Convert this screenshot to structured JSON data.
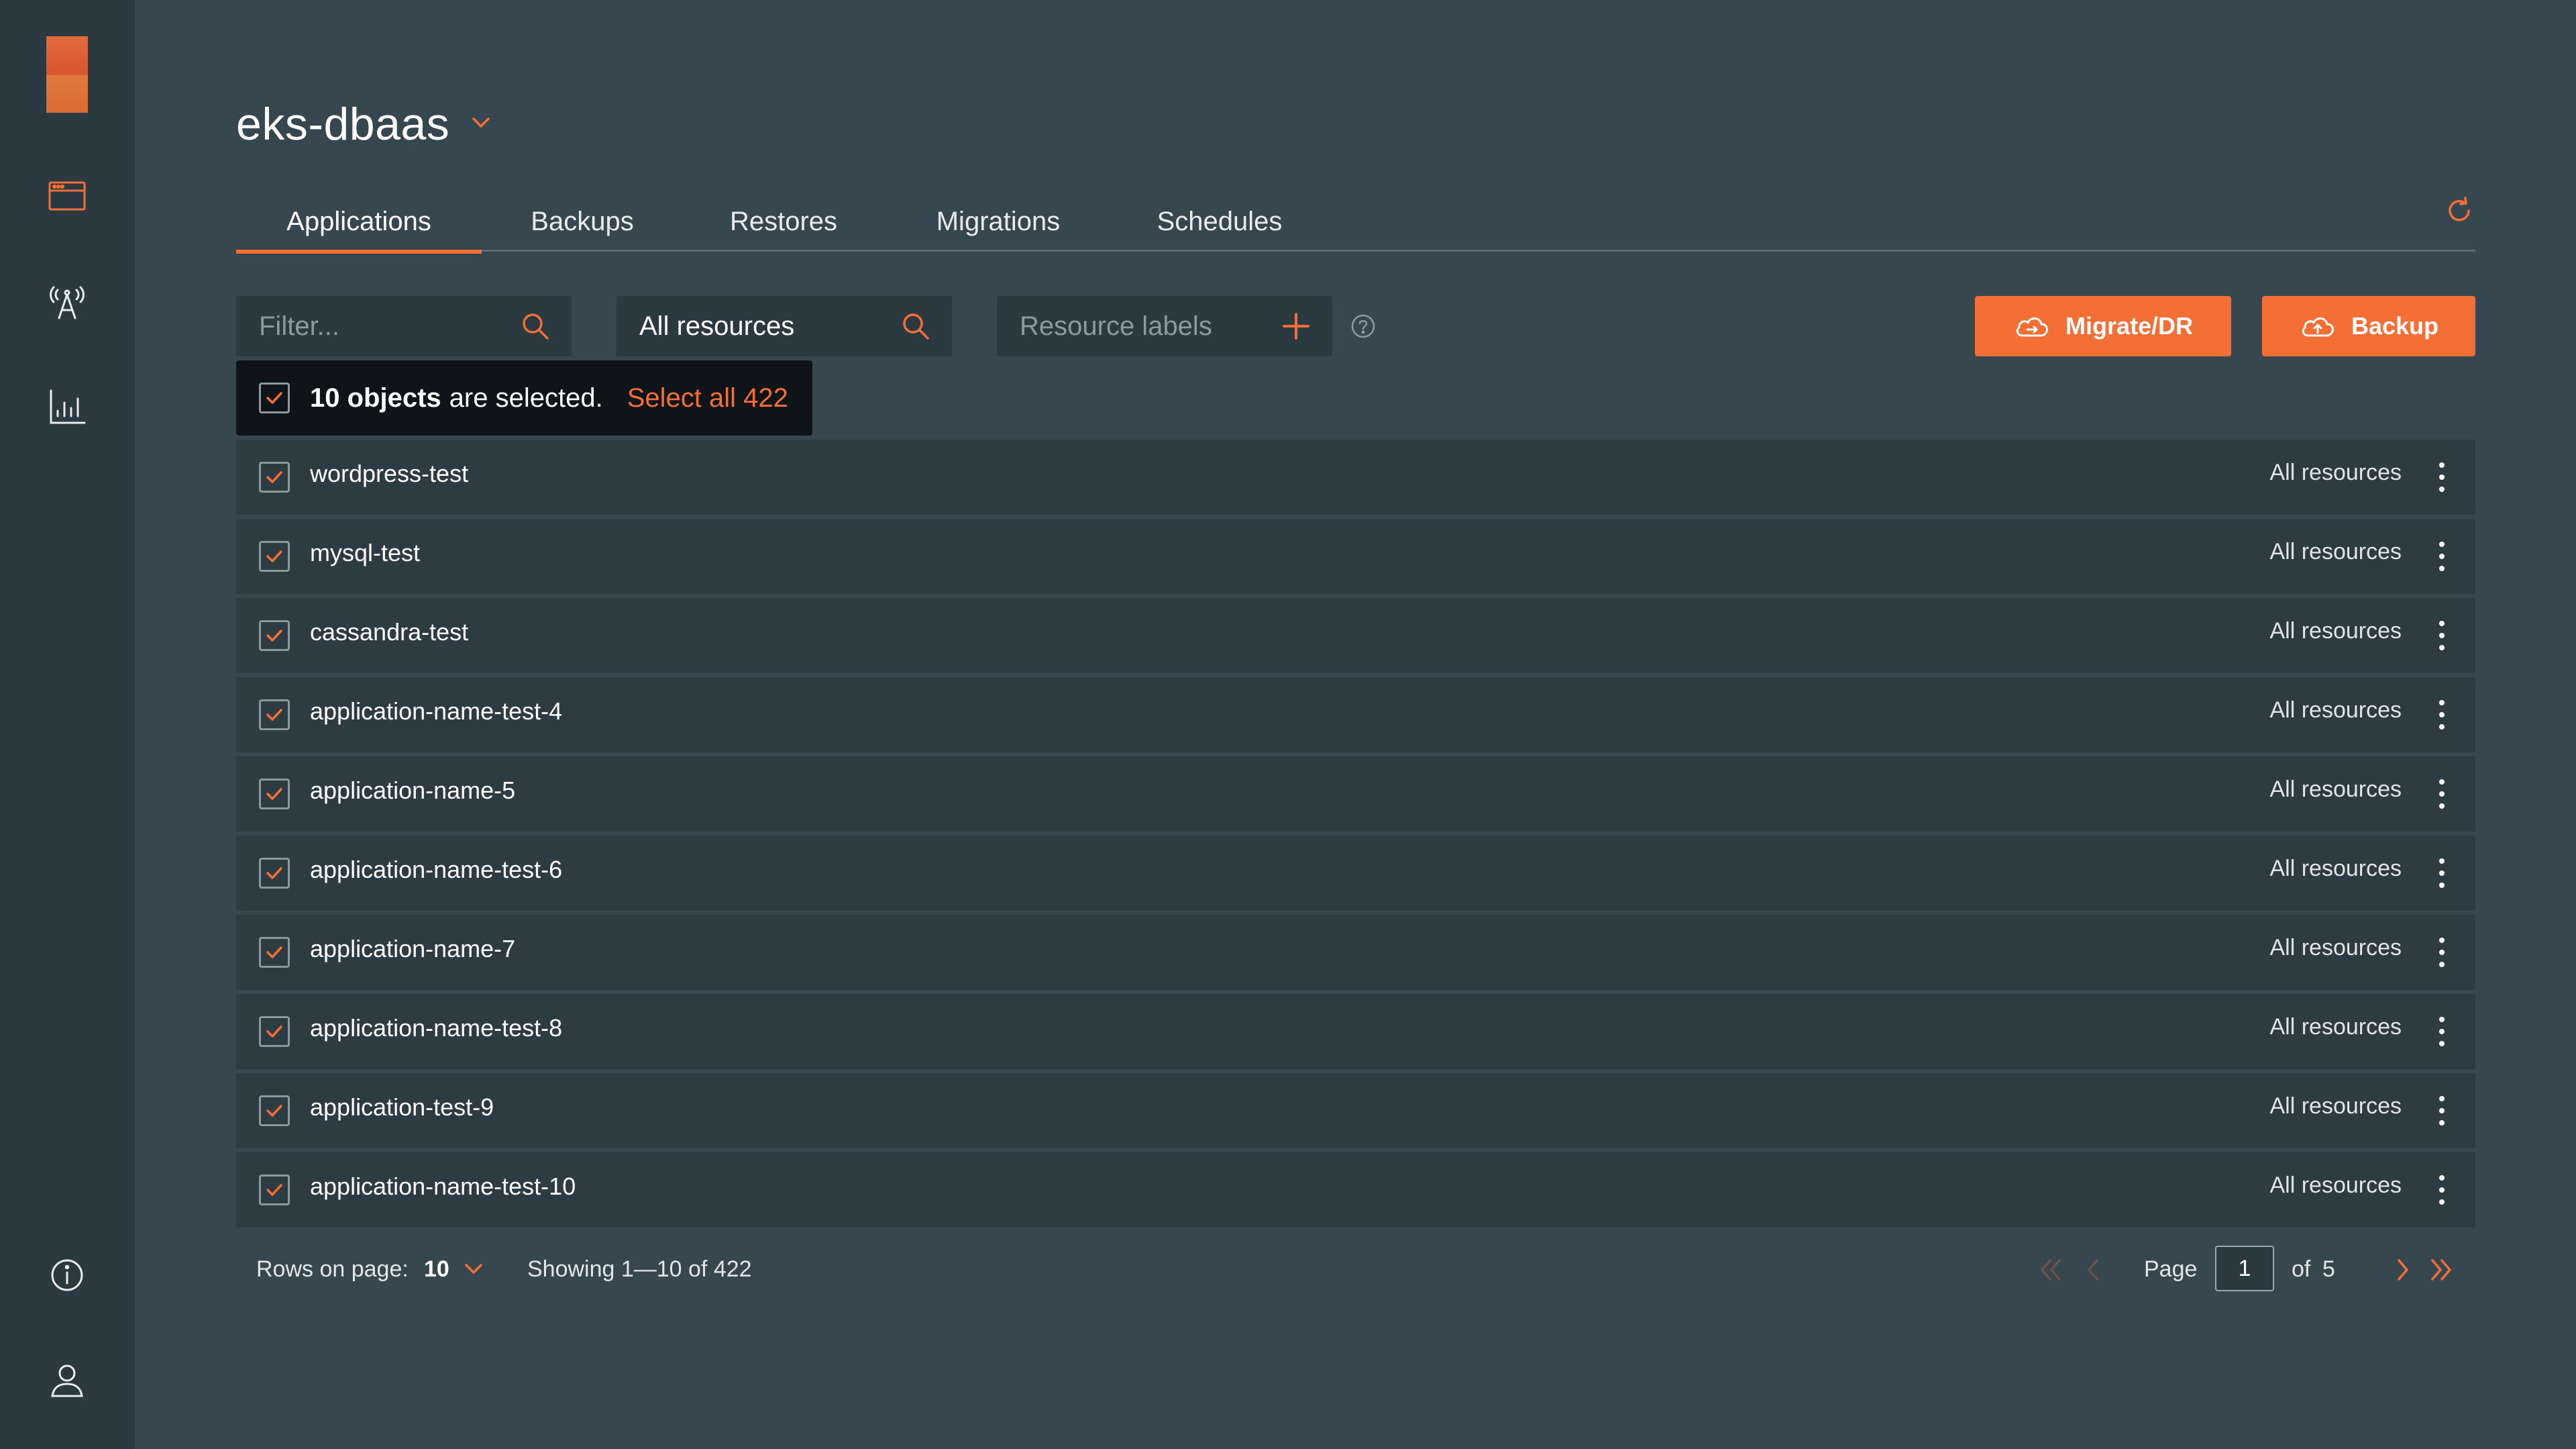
{
  "colors": {
    "accent": "#f36f36",
    "sidebar": "#2b3940",
    "background": "#37474f",
    "row": "#2d3b42"
  },
  "sidebar": {
    "icons": [
      "browser-window-icon",
      "antenna-icon",
      "bar-chart-icon",
      "info-icon",
      "user-icon"
    ]
  },
  "header": {
    "project_name": "eks-dbaas"
  },
  "tabs": [
    {
      "label": "Applications",
      "active": true
    },
    {
      "label": "Backups",
      "active": false
    },
    {
      "label": "Restores",
      "active": false
    },
    {
      "label": "Migrations",
      "active": false
    },
    {
      "label": "Schedules",
      "active": false
    }
  ],
  "toolbar": {
    "filter_placeholder": "Filter...",
    "resources_value": "All resources",
    "labels_placeholder": "Resource labels",
    "migrate_label": "Migrate/DR",
    "backup_label": "Backup"
  },
  "selection": {
    "count_text": "10 objects",
    "suffix": "are selected.",
    "select_all": "Select all 422"
  },
  "rows": [
    {
      "name": "wordpress-test",
      "scope": "All resources",
      "checked": true
    },
    {
      "name": "mysql-test",
      "scope": "All resources",
      "checked": true
    },
    {
      "name": "cassandra-test",
      "scope": "All resources",
      "checked": true
    },
    {
      "name": "application-name-test-4",
      "scope": "All resources",
      "checked": true
    },
    {
      "name": "application-name-5",
      "scope": "All resources",
      "checked": true
    },
    {
      "name": "application-name-test-6",
      "scope": "All resources",
      "checked": true
    },
    {
      "name": "application-name-7",
      "scope": "All resources",
      "checked": true
    },
    {
      "name": "application-name-test-8",
      "scope": "All resources",
      "checked": true
    },
    {
      "name": "application-test-9",
      "scope": "All resources",
      "checked": true
    },
    {
      "name": "application-name-test-10",
      "scope": "All resources",
      "checked": true
    }
  ],
  "footer": {
    "rows_label": "Rows on page:",
    "rows_value": "10",
    "showing": "Showing 1—10 of 422",
    "page_label": "Page",
    "page_value": "1",
    "of_label": "of",
    "total_pages": "5"
  }
}
